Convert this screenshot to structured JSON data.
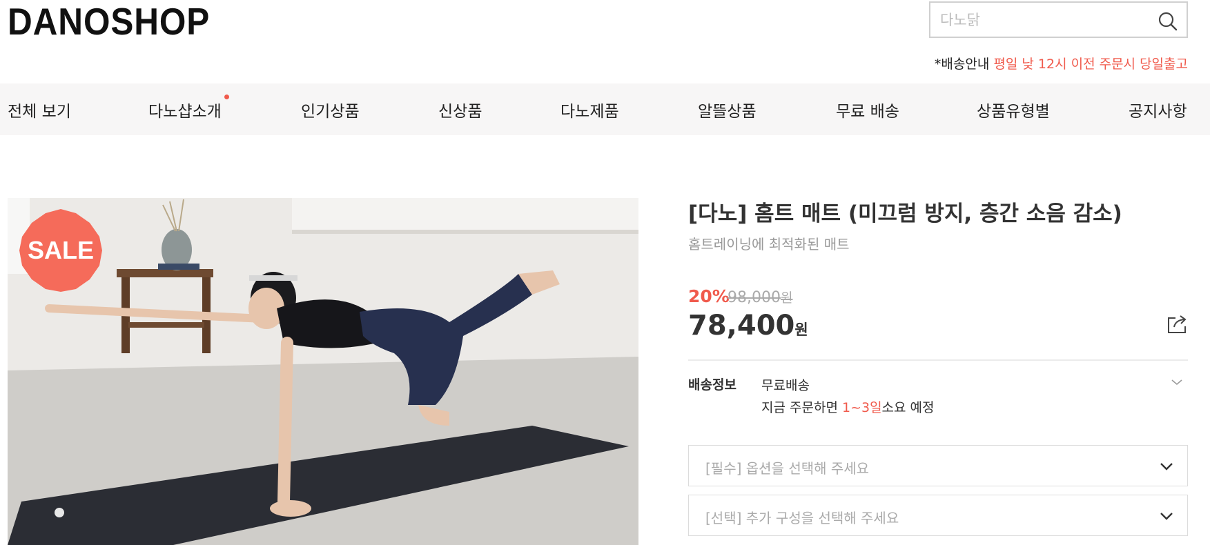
{
  "header": {
    "logo": "DANOSHOP",
    "search": {
      "placeholder": "다노닭",
      "icon": "search-icon"
    },
    "shipping_notice": {
      "prefix": "*배송안내 ",
      "highlight": "평일 낮 12시 이전 주문시 당일출고"
    }
  },
  "nav": {
    "items": [
      {
        "label": "전체 보기"
      },
      {
        "label": "다노샵소개"
      },
      {
        "label": "인기상품"
      },
      {
        "label": "신상품"
      },
      {
        "label": "다노제품"
      },
      {
        "label": "알뜰상품"
      },
      {
        "label": "무료 배송"
      },
      {
        "label": "상품유형별"
      },
      {
        "label": "공지사항"
      }
    ]
  },
  "product": {
    "badge": "SALE",
    "title": "[다노] 홈트 매트 (미끄럼 방지, 층간 소음 감소)",
    "subtitle": "홈트레이닝에 최적화된 매트",
    "discount": "20%",
    "original_price": "98,000",
    "original_unit": "원",
    "price": "78,400",
    "price_unit": "원",
    "share_icon": "share-icon"
  },
  "shipping": {
    "label": "배송정보",
    "line1": "무료배송",
    "line2_prefix": "지금 주문하면 ",
    "line2_days": "1~3일",
    "line2_suffix": "소요 예정"
  },
  "options": {
    "required_placeholder": "[필수] 옵션을 선택해 주세요",
    "optional_placeholder": "[선택] 추가 구성을 선택해 주세요"
  },
  "colors": {
    "accent": "#f05a4c",
    "nav_bg": "#f7f6f6",
    "mat": "#2b2d34"
  }
}
